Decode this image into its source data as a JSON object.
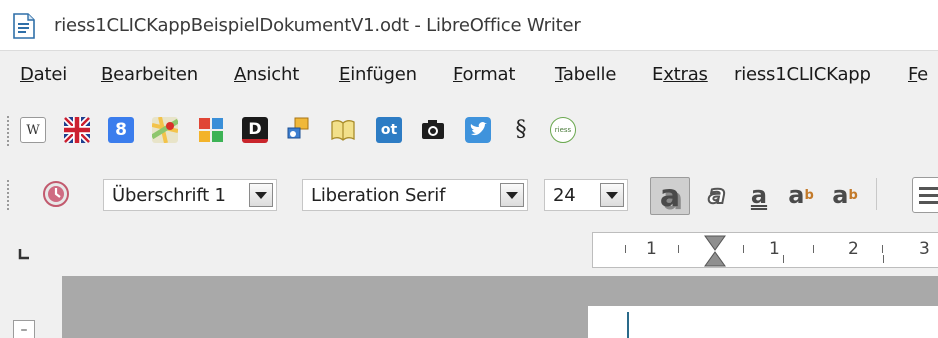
{
  "window": {
    "title": "riess1CLICKappBeispielDokumentV1.odt - LibreOffice Writer"
  },
  "menu": [
    {
      "first": "D",
      "rest": "atei"
    },
    {
      "first": "B",
      "rest": "earbeiten"
    },
    {
      "first": "A",
      "rest": "nsicht"
    },
    {
      "first": "E",
      "rest": "infügen"
    },
    {
      "first": "F",
      "rest": "ormat"
    },
    {
      "first": "T",
      "rest": "abelle"
    },
    {
      "first": "E",
      "rest": "xtras"
    },
    {
      "first": "",
      "rest": "riess1CLICKapp"
    },
    {
      "first": "F",
      "rest": "e"
    }
  ],
  "toolbar_custom": {
    "icons": [
      "wikipedia-icon",
      "uk-flag-icon",
      "google-icon",
      "maps-icon",
      "puzzle-icon",
      "duden-icon",
      "tools-icon",
      "book-icon",
      "ot-icon",
      "camera-icon",
      "twitter-icon",
      "section-icon",
      "riess-logo-icon"
    ],
    "wikipedia": "W",
    "google": "8",
    "duden": "D",
    "ot": "ot",
    "section": "§",
    "riess": "riess"
  },
  "formatting": {
    "paragraph_style": "Überschrift 1",
    "font_name": "Liberation Serif",
    "font_size": "24",
    "glyph": "a"
  },
  "ruler": {
    "numbers": [
      "1",
      "1",
      "2",
      "3"
    ]
  },
  "colors": {
    "toolbar_bg": "#f0f0f0",
    "doc_bg": "#a9a9a9"
  }
}
